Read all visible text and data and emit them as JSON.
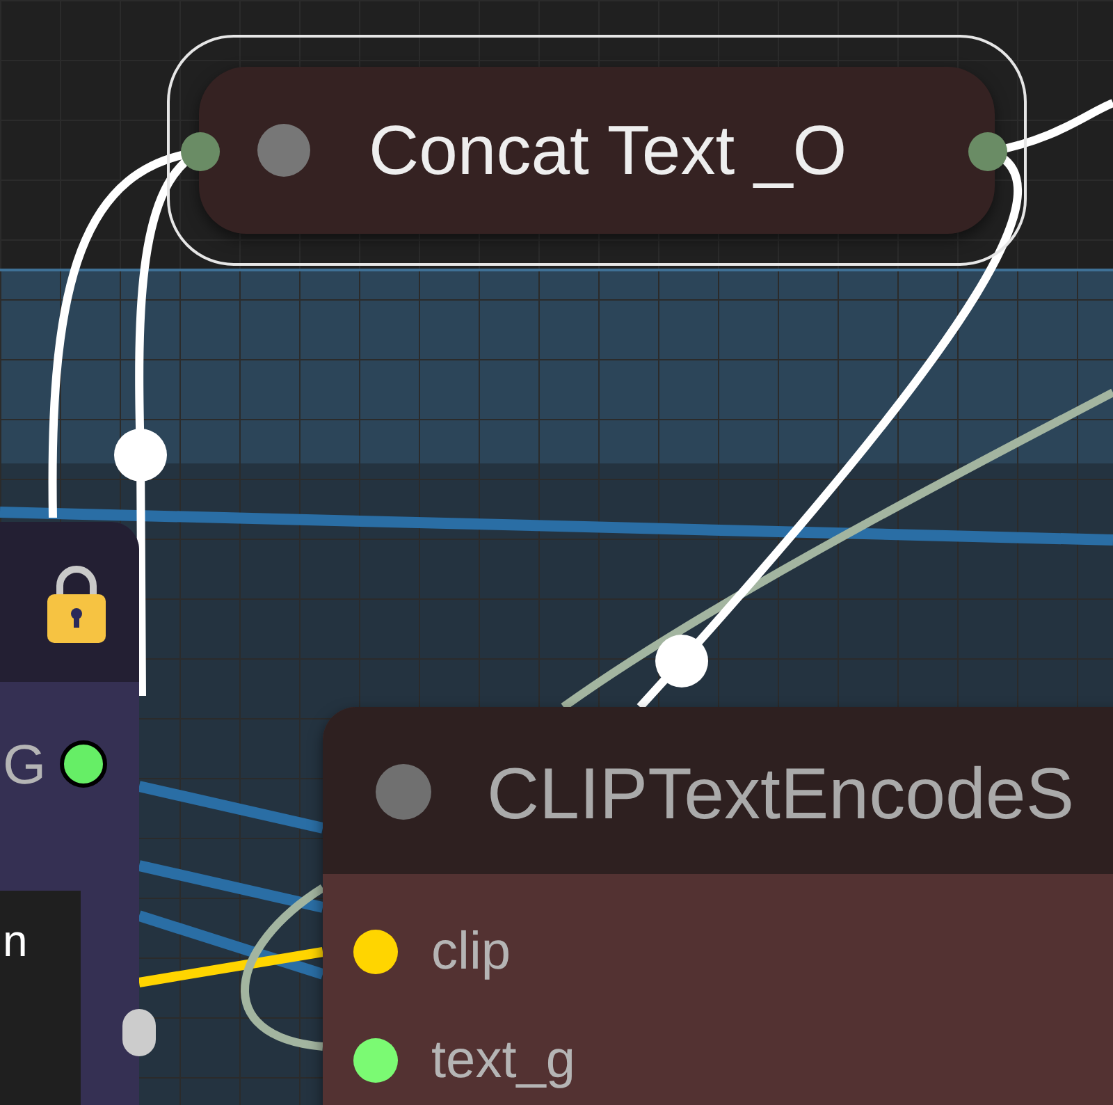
{
  "nodes": [
    {
      "title": "Concat Text _O",
      "selected": true,
      "slots": [
        {
          "color": "#6a8c65"
        },
        {
          "color": "#6a8c65"
        }
      ]
    },
    {
      "locked": true,
      "output": {
        "label": "G",
        "color": "#66ee66"
      },
      "widget": {
        "value": "n"
      }
    },
    {
      "title": "CLIPTextEncodeS",
      "inputs": [
        {
          "label": "clip",
          "color": "#ffd500"
        },
        {
          "label": "text_g",
          "color": "#7bfa73"
        }
      ]
    }
  ]
}
